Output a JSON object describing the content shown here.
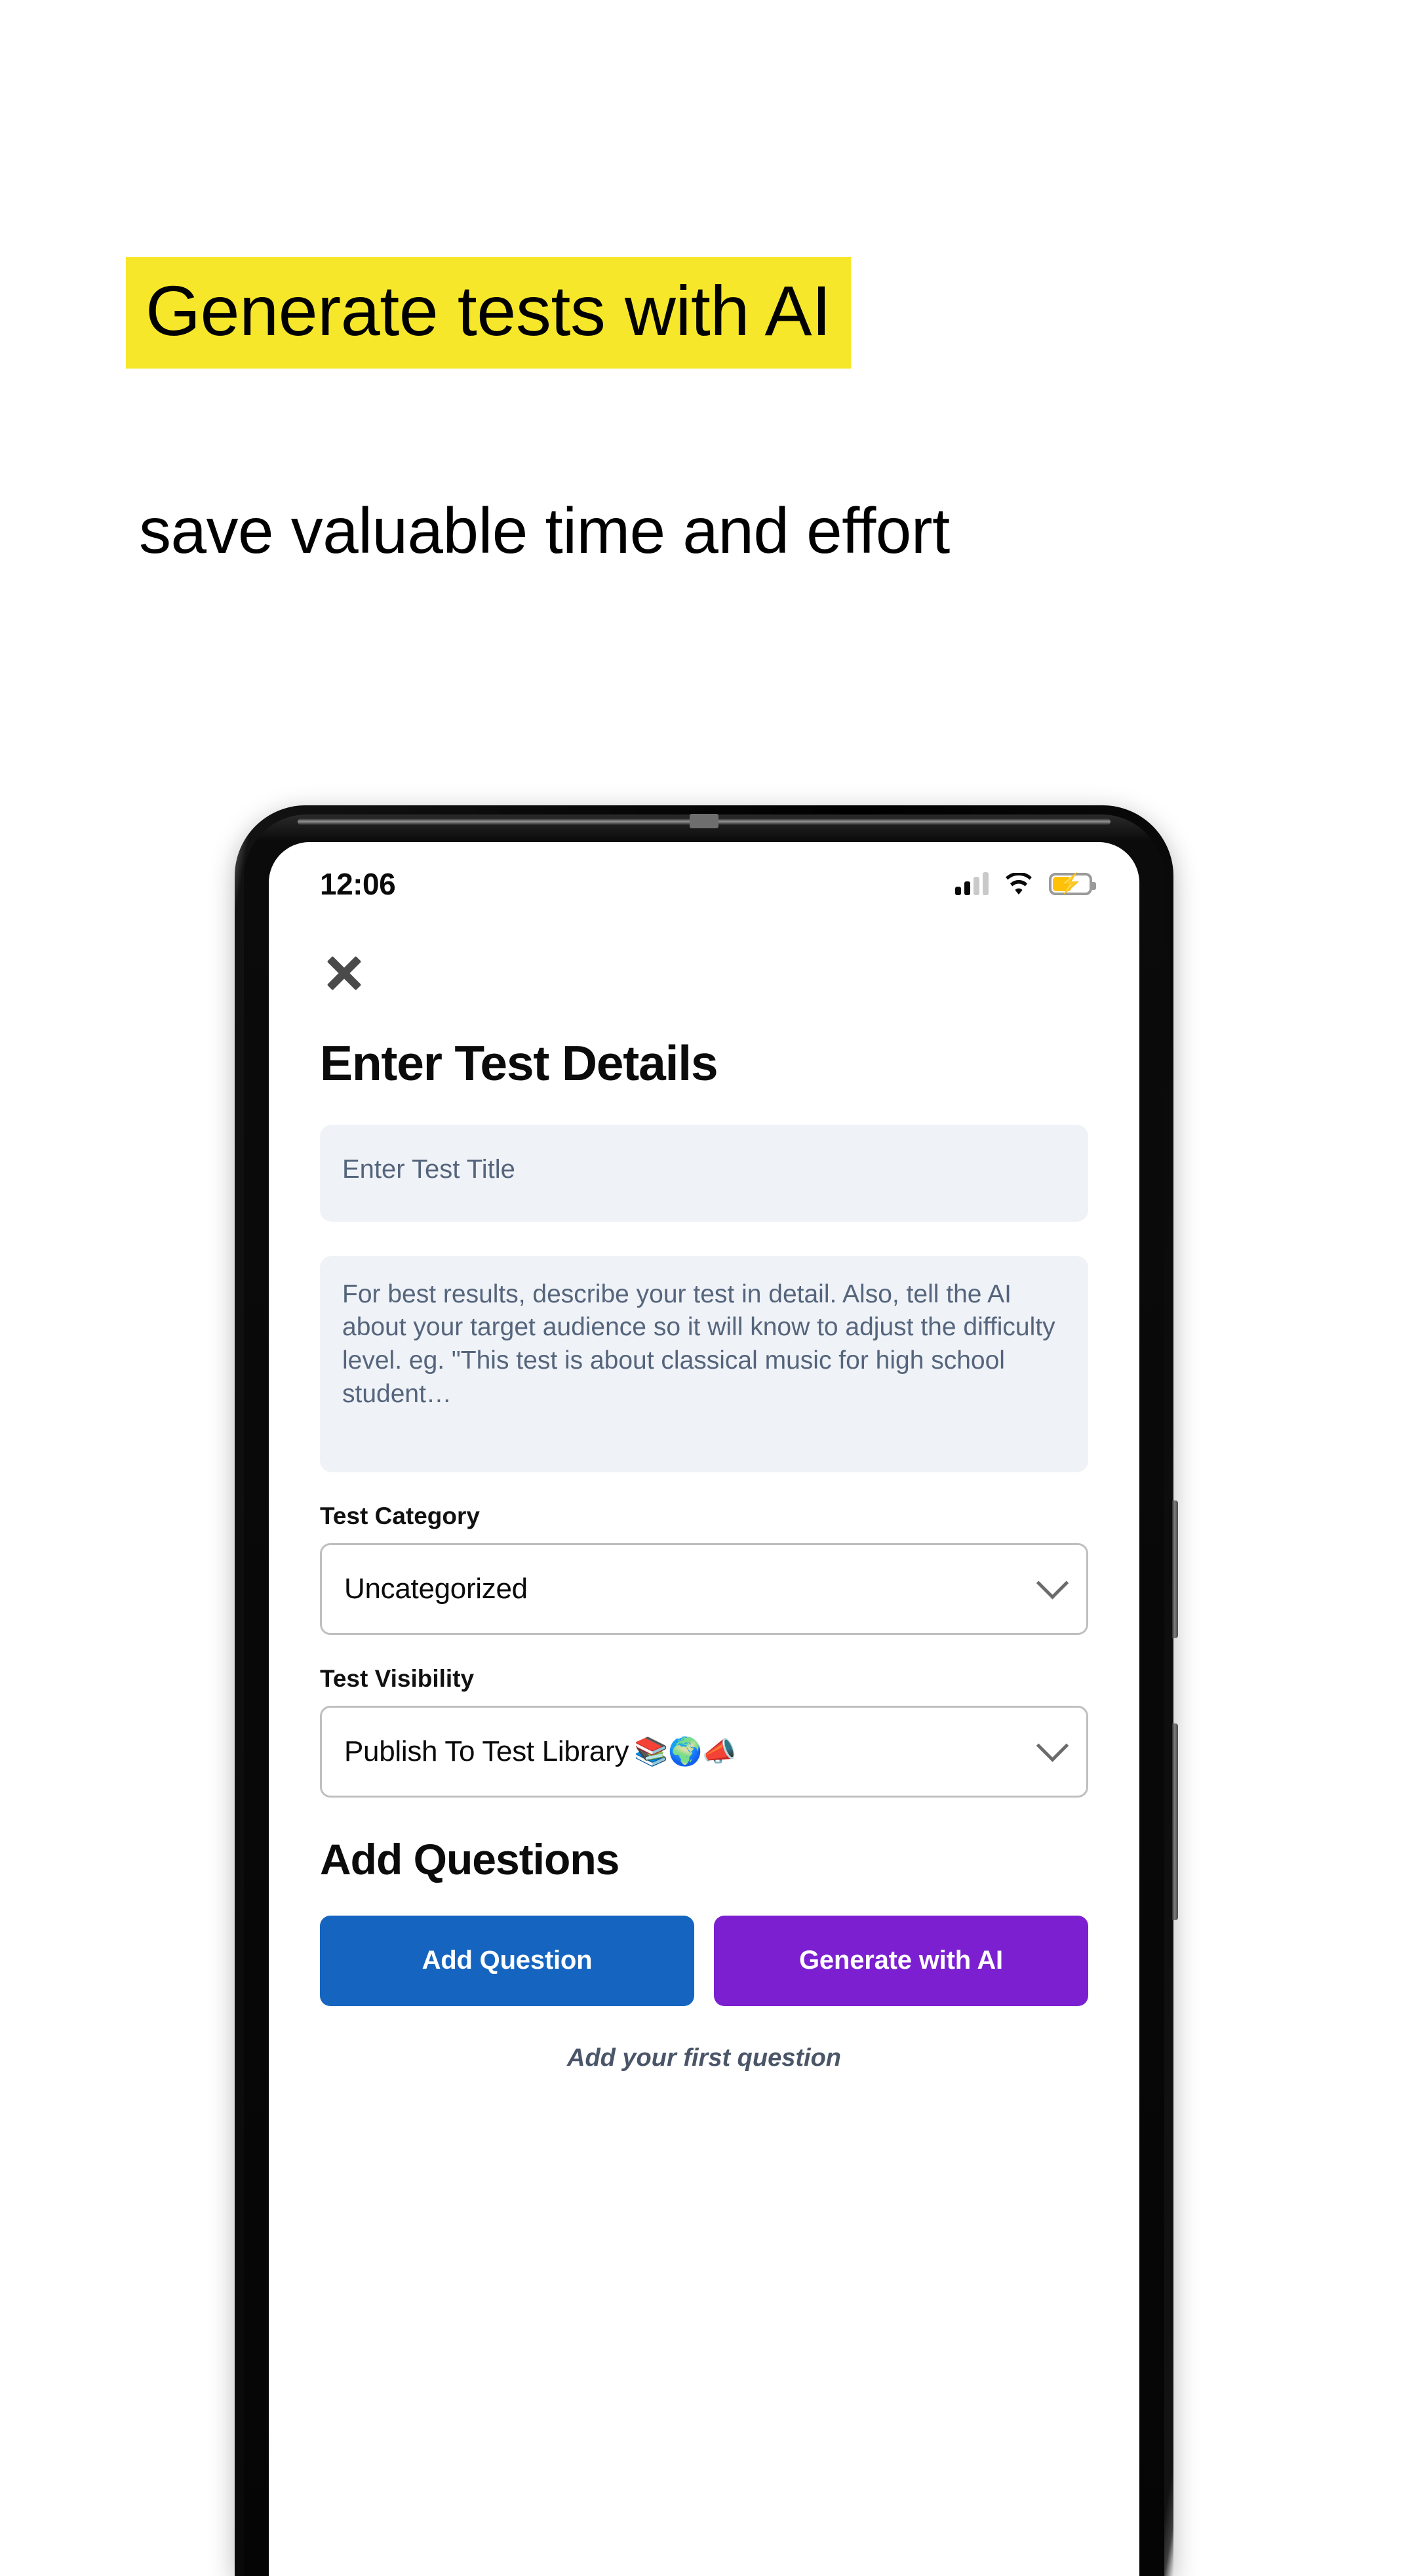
{
  "promo": {
    "headline": "Generate tests with AI",
    "subheadline": "save valuable time and effort",
    "highlight_color": "#F7E72A"
  },
  "phone": {
    "status_bar": {
      "time": "12:06",
      "signal_icon": "signal-bars-icon",
      "wifi_icon": "wifi-icon",
      "battery_icon": "battery-charging-icon",
      "battery_fill_color": "#FFC107",
      "battery_level_percent": 48
    },
    "screen": {
      "close_icon": "close-icon",
      "page_title": "Enter Test Details",
      "title_field": {
        "value": "",
        "placeholder": "Enter Test Title"
      },
      "description_field": {
        "value": "",
        "placeholder": "For best results, describe your test in detail. Also, tell the AI about your target audience so it will know to adjust the difficulty level. eg. \"This test is about classical music for high school student…"
      },
      "category_group": {
        "label": "Test Category",
        "selected": "Uncategorized",
        "chevron_icon": "chevron-down-icon"
      },
      "visibility_group": {
        "label": "Test Visibility",
        "selected": "Publish To Test Library",
        "emojis": "📚🌍📣",
        "chevron_icon": "chevron-down-icon"
      },
      "questions_section": {
        "title": "Add Questions",
        "add_question_label": "Add Question",
        "add_question_color": "#1565C0",
        "generate_ai_label": "Generate with AI",
        "generate_ai_color": "#7B1FD0",
        "empty_hint": "Add your first question"
      }
    }
  }
}
